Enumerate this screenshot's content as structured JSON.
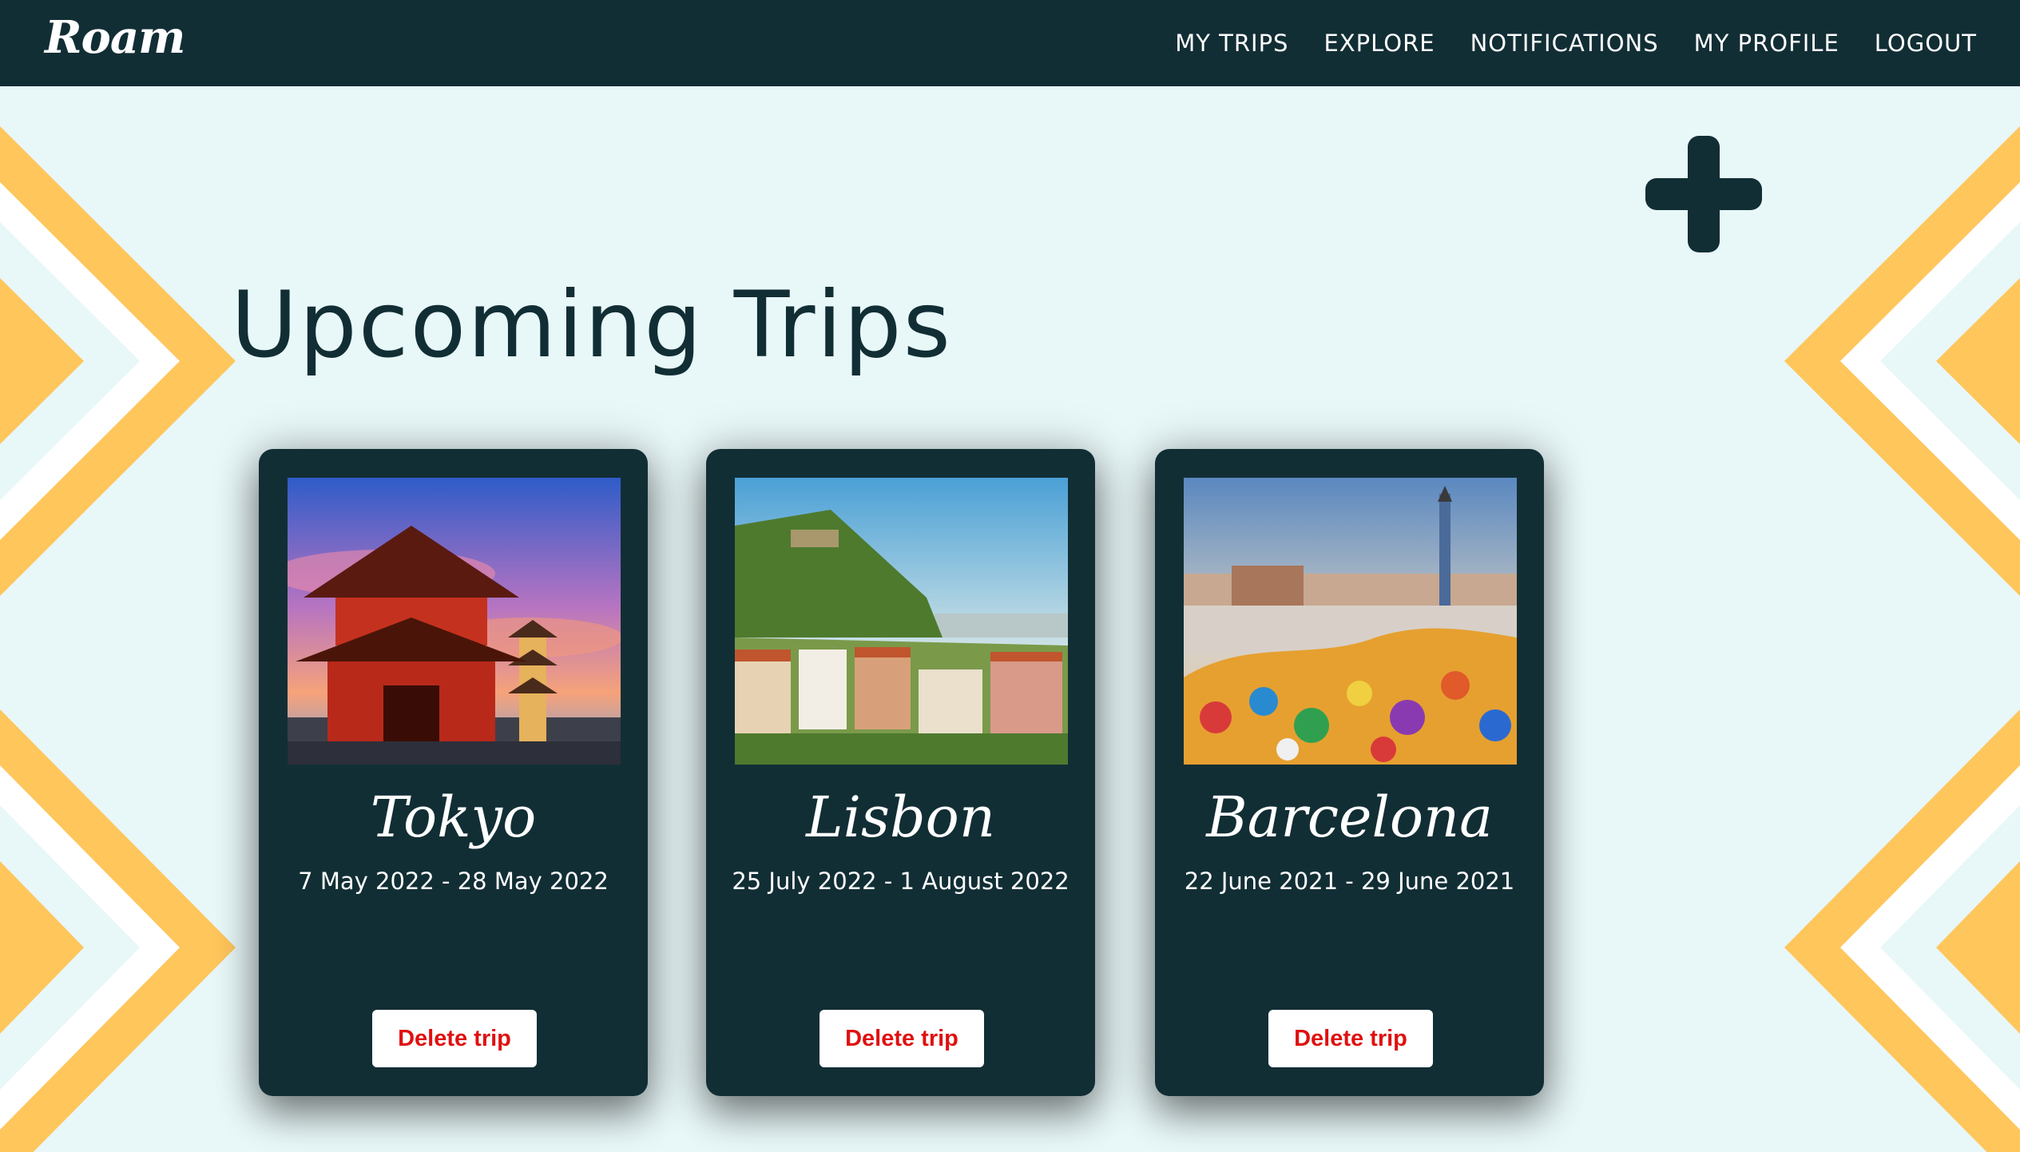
{
  "app": {
    "brand": "Roam"
  },
  "nav": {
    "items": [
      {
        "label": "MY TRIPS"
      },
      {
        "label": "EXPLORE"
      },
      {
        "label": "NOTIFICATIONS"
      },
      {
        "label": "MY PROFILE"
      },
      {
        "label": "LOGOUT"
      }
    ]
  },
  "main": {
    "title": "Upcoming Trips",
    "add_icon": "plus-icon",
    "trips": [
      {
        "city": "Tokyo",
        "dates": "7 May 2022 - 28 May 2022",
        "delete_label": "Delete trip"
      },
      {
        "city": "Lisbon",
        "dates": "25 July 2022 - 1 August 2022",
        "delete_label": "Delete trip"
      },
      {
        "city": "Barcelona",
        "dates": "22 June 2021 - 29 June 2021",
        "delete_label": "Delete trip"
      }
    ]
  },
  "colors": {
    "header_bg": "#122e35",
    "page_bg": "#e8f7f8",
    "accent_yellow": "#ffc65c",
    "delete_text": "#e01010"
  }
}
